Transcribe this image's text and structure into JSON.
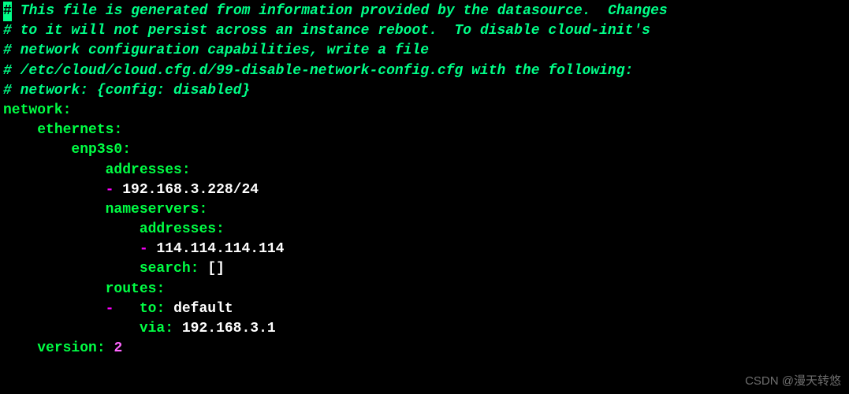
{
  "comments": {
    "line1_hash": "#",
    "line1": " This file is generated from information provided by the datasource.  Changes",
    "line2": "# to it will not persist across an instance reboot.  To disable cloud-init's",
    "line3": "# network configuration capabilities, write a file",
    "line4": "# /etc/cloud/cloud.cfg.d/99-disable-network-config.cfg with the following:",
    "line5": "# network: {config: disabled}"
  },
  "yaml": {
    "network_key": "network",
    "ethernets_key": "ethernets",
    "interface_key": "enp3s0",
    "addresses_key": "addresses",
    "ip_address": "192.168.3.228/24",
    "nameservers_key": "nameservers",
    "ns_addresses_key": "addresses",
    "ns_address": "114.114.114.114",
    "search_key": "search",
    "search_value": "[]",
    "routes_key": "routes",
    "to_key": "to",
    "to_value": "default",
    "via_key": "via",
    "via_value": "192.168.3.1",
    "version_key": "version",
    "version_value": "2",
    "dash": "-",
    "colon": ":"
  },
  "watermark": "CSDN @漫天转悠"
}
